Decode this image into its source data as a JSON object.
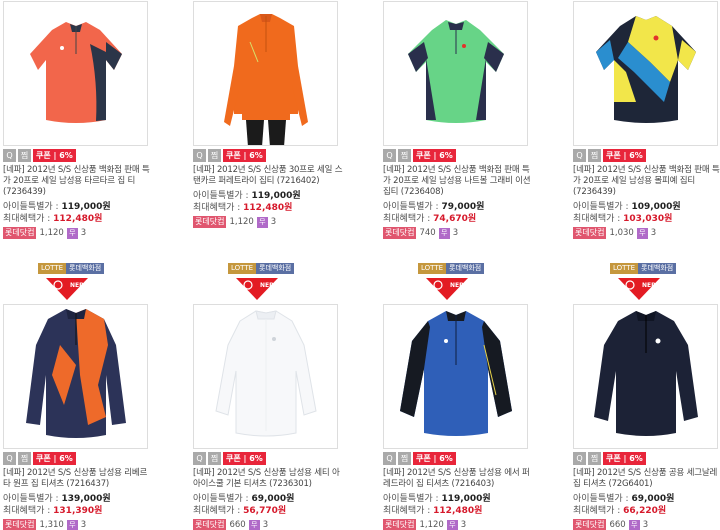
{
  "icons": {
    "zoom": "magnifier-icon",
    "zzim": "heart-icon"
  },
  "colors": {
    "coupon": "#e8253a",
    "benefit_price": "#d6192b",
    "lotte_gold": "#c5973d",
    "lotte_blue": "#5a6fa3",
    "nepa_red": "#e31b23"
  },
  "brand_badge": {
    "store_left": "LOTTE",
    "store_right": "롯데백화점",
    "logo": "NEPA"
  },
  "common": {
    "tool_zoom": "Q",
    "tool_zzim": "찜",
    "coupon": "쿠폰 | 6%",
    "price_label": "아이들특별가 : ",
    "benefit_label": "최대혜택가 : ",
    "store_badge": "롯데닷컴",
    "free_badge": "무"
  },
  "products": [
    {
      "desc": "[네파] 2012년 S/S 신상품 백화점 판매 특가 20프로 세일 남성용 타르타르 집 티 (7236439)",
      "price": "119,000원",
      "benefit": "112,480원",
      "rating": "1,120",
      "reviews": "3"
    },
    {
      "desc": "[네파] 2012년 S/S 신상품 30프로 세일 스탠카르 퍼레트라이 집티 (7216402)",
      "price": "119,000원",
      "benefit": "112,480원",
      "rating": "1,120",
      "reviews": "3"
    },
    {
      "desc": "[네파] 2012년 S/S 신상품 백화점 판매 특가 20프로 세일 남성용 나트볼 그래비 이션 집티 (7236408)",
      "price": "79,000원",
      "benefit": "74,670원",
      "rating": "740",
      "reviews": "3"
    },
    {
      "desc": "[네파] 2012년 S/S 신상품 백화점 판매 특가 20프로 세일 남성용 몰피예 집티 (7236439)",
      "price": "109,000원",
      "benefit": "103,030원",
      "rating": "1,030",
      "reviews": "3"
    },
    {
      "desc": "[네파] 2012년 S/S 신상품 남성용 리베르 타 원프 집 티셔츠 (7216437)",
      "price": "139,000원",
      "benefit": "131,390원",
      "rating": "1,310",
      "reviews": "3"
    },
    {
      "desc": "[네파] 2012년 S/S 신상품 남성용 세티 아 아이스쿨 기본 티셔츠 (7236301)",
      "price": "69,000원",
      "benefit": "56,770원",
      "rating": "660",
      "reviews": "3"
    },
    {
      "desc": "[네파] 2012년 S/S 신상품 남성용 에서 퍼레드라이 집 티셔츠 (7216403)",
      "price": "119,000원",
      "benefit": "112,480원",
      "rating": "1,120",
      "reviews": "3"
    },
    {
      "desc": "[네파] 2012년 S/S 신상품 공용 세그날레 집 티셔츠 (72G6401)",
      "price": "69,000원",
      "benefit": "66,220원",
      "rating": "660",
      "reviews": "3"
    }
  ]
}
